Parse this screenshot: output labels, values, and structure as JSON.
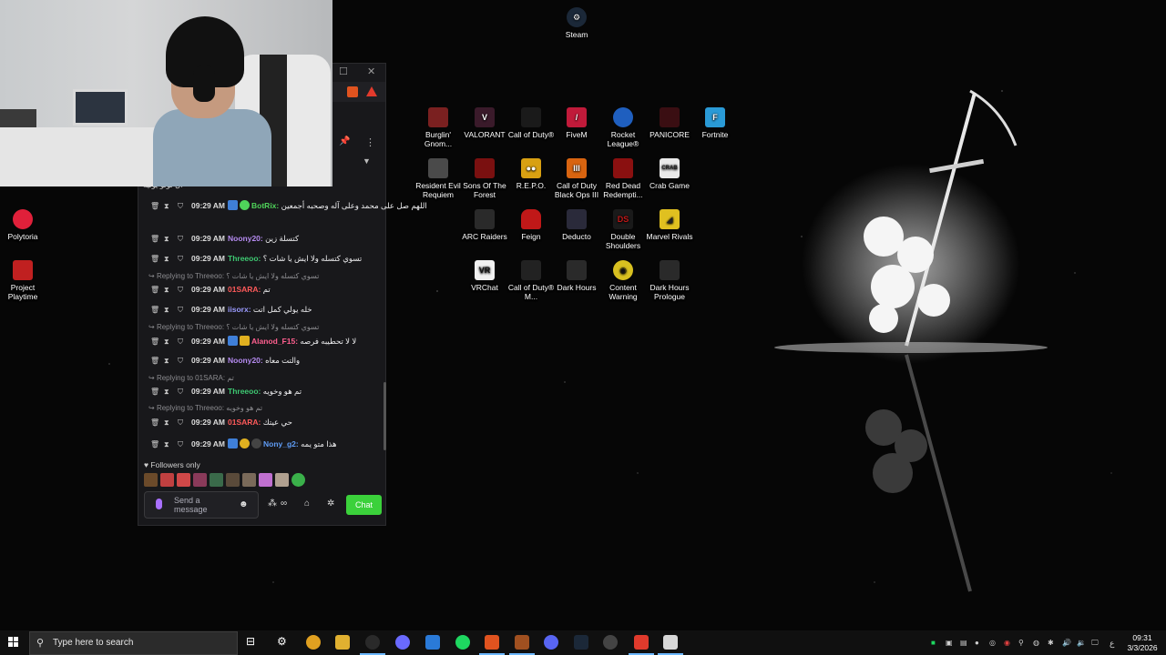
{
  "desktop": {
    "icons": [
      {
        "label": "Steam",
        "icon": "steam-icon",
        "color": "#1b2838"
      },
      {
        "label": "Burglin' Gnom...",
        "icon": "burglin-gnomes-icon",
        "color": "#7a2020"
      },
      {
        "label": "VALORANT",
        "icon": "valorant-icon",
        "color": "#3a1a2a"
      },
      {
        "label": "Call of Duty®",
        "icon": "call-of-duty-icon",
        "color": "#1a1a1a"
      },
      {
        "label": "FiveM",
        "icon": "fivem-icon",
        "color": "#c01a3a"
      },
      {
        "label": "Rocket League®",
        "icon": "rocket-league-icon",
        "color": "#1f5fbf"
      },
      {
        "label": "PANICORE",
        "icon": "panicore-icon",
        "color": "#3a0e12"
      },
      {
        "label": "Fortnite",
        "icon": "fortnite-icon",
        "color": "#2a9ad6"
      },
      {
        "label": "Resident Evil Requiem",
        "icon": "resident-evil-icon",
        "color": "#4a4a4a"
      },
      {
        "label": "Sons Of The Forest",
        "icon": "sons-of-the-forest-icon",
        "color": "#7a1010"
      },
      {
        "label": "R.E.P.O.",
        "icon": "repo-icon",
        "color": "#d8a012"
      },
      {
        "label": "Call of Duty Black Ops III",
        "icon": "black-ops-iii-icon",
        "color": "#d86410"
      },
      {
        "label": "Red Dead Redempti...",
        "icon": "red-dead-icon",
        "color": "#8a1010"
      },
      {
        "label": "Crab Game",
        "icon": "crab-game-icon",
        "color": "#e9e9e9"
      },
      {
        "label": "ARC Raiders",
        "icon": "arc-raiders-icon",
        "color": "#2a2a2a"
      },
      {
        "label": "Feign",
        "icon": "feign-icon",
        "color": "#c01818"
      },
      {
        "label": "Deducto",
        "icon": "deducto-icon",
        "color": "#2a2a3a"
      },
      {
        "label": "Double Shoulders",
        "icon": "double-shoulders-icon",
        "color": "#1a1a1a"
      },
      {
        "label": "Marvel Rivals",
        "icon": "marvel-rivals-icon",
        "color": "#e0c020"
      },
      {
        "label": "VRChat",
        "icon": "vrchat-icon",
        "color": "#f0f0f0"
      },
      {
        "label": "Call of Duty® M...",
        "icon": "cod-mw-icon",
        "color": "#222222"
      },
      {
        "label": "Dark Hours",
        "icon": "dark-hours-icon",
        "color": "#2a2a2a"
      },
      {
        "label": "Content Warning",
        "icon": "content-warning-icon",
        "color": "#d8c020"
      },
      {
        "label": "Dark Hours Prologue",
        "icon": "dark-hours-prologue-icon",
        "color": "#2a2a2a"
      },
      {
        "label": "Polytoria",
        "icon": "polytoria-icon",
        "color": "#e0203a"
      },
      {
        "label": "Project Playtime",
        "icon": "project-playtime-icon",
        "color": "#c02020"
      }
    ]
  },
  "chat": {
    "partial_top": "ال لولو يوليه",
    "messages": [
      {
        "time": "09:29 AM",
        "user": "BotRix:",
        "user_color": "#4fd35a",
        "text": "اللهم صل على محمد وعلى آله وصحبه أجمعين",
        "badges": [
          "prime",
          "verified"
        ]
      },
      {
        "time": "09:29 AM",
        "user": "Noony20:",
        "user_color": "#b58bf0",
        "text": "كتسلة زين",
        "badges": []
      },
      {
        "time": "09:29 AM",
        "user": "Threeoo:",
        "user_color": "#3ec972",
        "text": "تسوي كتسله ولا ايش يا شات ؟",
        "badges": []
      },
      {
        "time": "09:29 AM",
        "user": "01SARA:",
        "user_color": "#ff5a5a",
        "text": "تم",
        "badges": []
      },
      {
        "time": "09:29 AM",
        "user": "iisorx:",
        "user_color": "#9b9bff",
        "text": "خله يولي كمل اتت",
        "badges": []
      },
      {
        "time": "09:29 AM",
        "user": "Alanod_F15:",
        "user_color": "#ff5f8f",
        "text": "لا لا تحطيبه فرصه",
        "badges": [
          "prime",
          "crown"
        ]
      },
      {
        "time": "09:29 AM",
        "user": "Noony20:",
        "user_color": "#b58bf0",
        "text": "والتت معاه",
        "badges": []
      },
      {
        "time": "09:29 AM",
        "user": "Threeoo:",
        "user_color": "#3ec972",
        "text": "تم هو وخويه",
        "badges": []
      },
      {
        "time": "09:29 AM",
        "user": "01SARA:",
        "user_color": "#ff5a5a",
        "text": "حي عيتك",
        "badges": []
      },
      {
        "time": "09:29 AM",
        "user": "Nony_g2:",
        "user_color": "#5f9cf5",
        "text": "هذا متو يمه",
        "badges": [
          "prime",
          "gold",
          "moon"
        ]
      }
    ],
    "replies": [
      {
        "label": "Replying to Threeoo:",
        "quote": "تسوي كتسله ولا ايش يا شات ؟"
      },
      {
        "label": "Replying to Threeoo:",
        "quote": "تسوي كتسله ولا ايش يا شات ؟"
      },
      {
        "label": "Replying to 01SARA:",
        "quote": "تم"
      },
      {
        "label": "Replying to Threeoo:",
        "quote": "تم هو وخويه"
      }
    ],
    "followers_only": "Followers only",
    "input_placeholder": "Send a message",
    "chat_button": "Chat",
    "accent": "#3bd13b"
  },
  "taskbar": {
    "search_placeholder": "Type here to search",
    "time": "09:31",
    "date": "3/3/2026",
    "language": "ع"
  }
}
